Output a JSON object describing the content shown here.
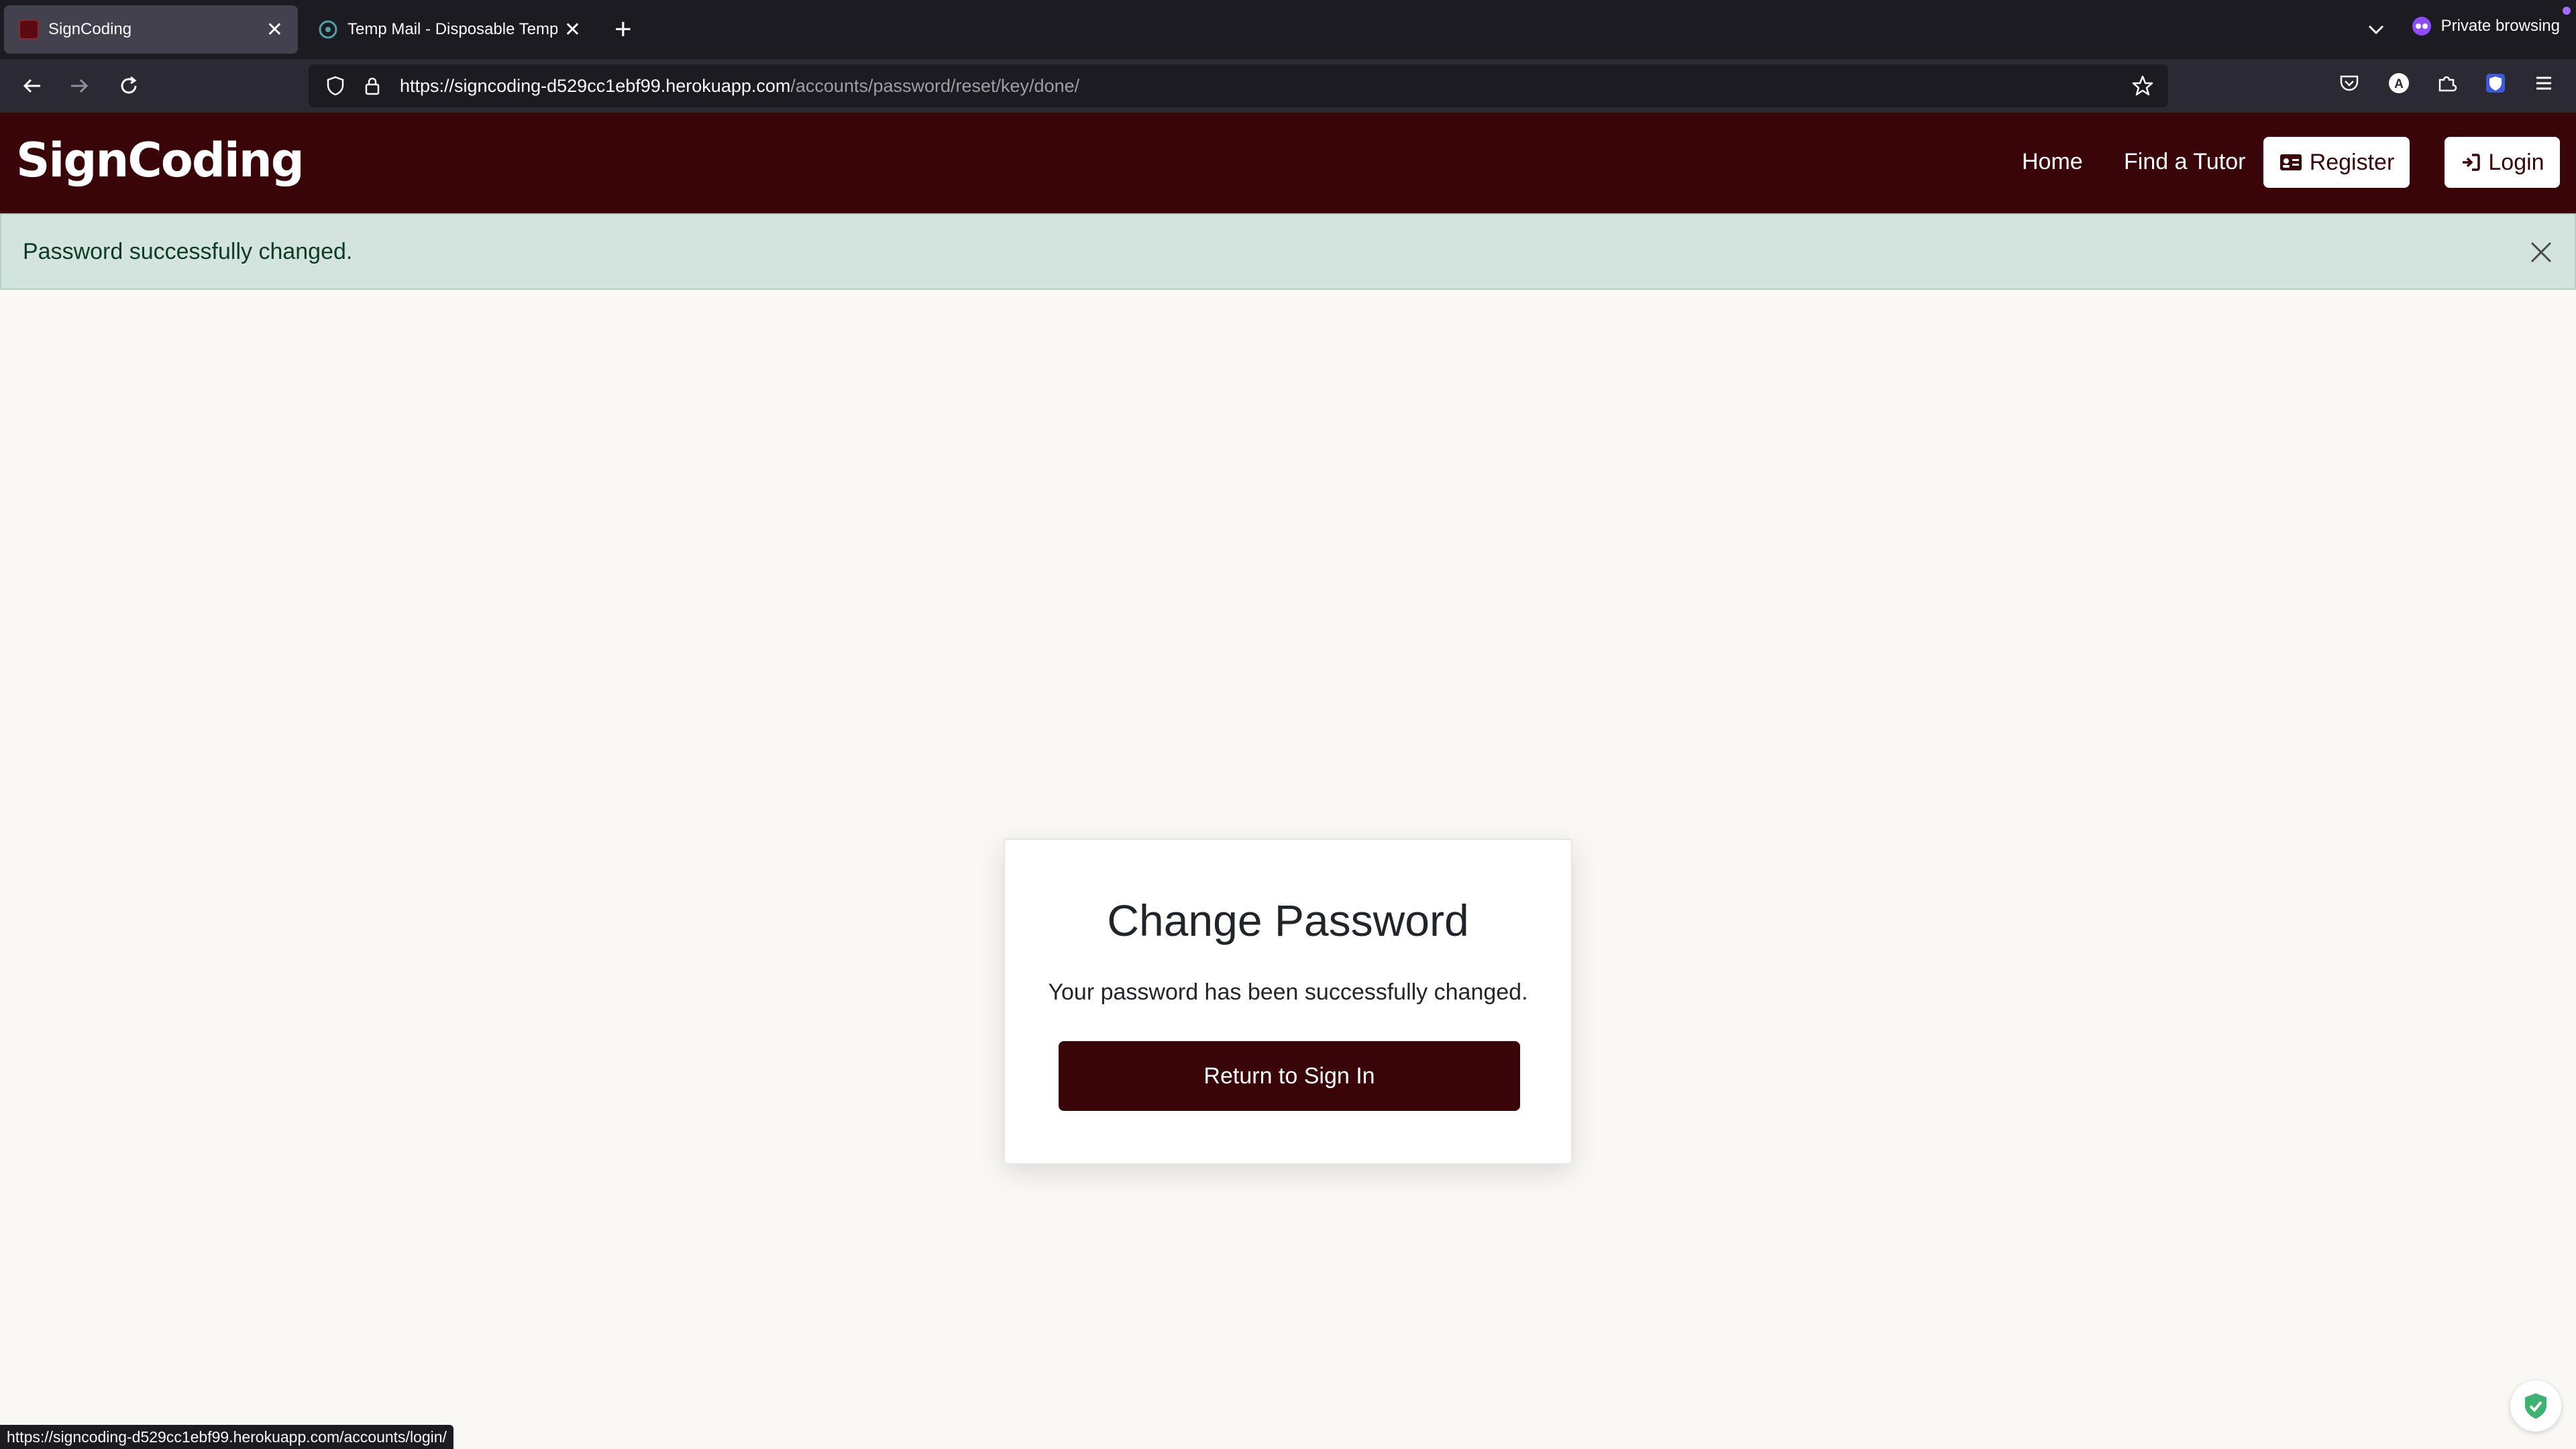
{
  "browser": {
    "tabs": [
      {
        "title": "SignCoding",
        "active": true,
        "icon": "signcoding-favicon"
      },
      {
        "title": "Temp Mail - Disposable Tempor",
        "active": false,
        "icon": "tempmail-favicon"
      }
    ],
    "private_label": "Private browsing",
    "url_host": "https://signcoding-d529cc1ebf99.herokuapp.com",
    "url_path": "/accounts/password/reset/key/done/",
    "status_url": "https://signcoding-d529cc1ebf99.herokuapp.com/accounts/login/"
  },
  "site": {
    "logo": "SignCoding",
    "nav": {
      "home": "Home",
      "find_tutor": "Find a Tutor",
      "register": "Register",
      "login": "Login"
    }
  },
  "alert": {
    "message": "Password successfully changed."
  },
  "card": {
    "title": "Change Password",
    "message": "Your password has been successfully changed.",
    "button": "Return to Sign In"
  },
  "colors": {
    "brand": "#3a0509",
    "alert_bg": "#d2e4dd",
    "page_bg": "#f9f8f5"
  }
}
